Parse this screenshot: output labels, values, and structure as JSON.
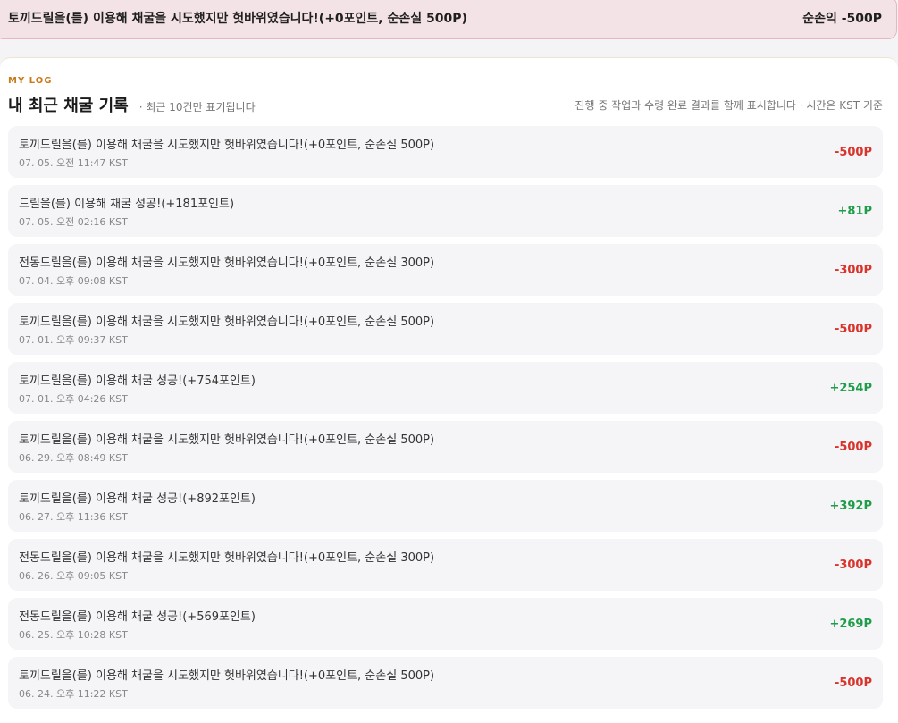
{
  "banner": {
    "message": "토끼드릴을(를) 이용해 채굴을 시도했지만 헛바위였습니다!(+0포인트, 순손실 500P)",
    "net_label": "순손익 -500P"
  },
  "section": {
    "kicker": "MY LOG",
    "title": "내 최근 채굴 기록",
    "subtitle": "· 최근 10건만 표기됩니다",
    "note": "진행 중 작업과 수령 완료 결과를 함께 표시합니다 · 시간은 KST 기준"
  },
  "colors": {
    "negative": "#d9342c",
    "positive": "#1f9d4a",
    "kicker": "#c97a1c",
    "banner_bg": "#f3e3e6"
  },
  "records": [
    {
      "message": "토끼드릴을(를) 이용해 채굴을 시도했지만 헛바위였습니다!(+0포인트, 순손실 500P)",
      "time": "07. 05. 오전 11:47 KST",
      "delta": "-500P",
      "sign": "neg"
    },
    {
      "message": "드릴을(를) 이용해 채굴 성공!(+181포인트)",
      "time": "07. 05. 오전 02:16 KST",
      "delta": "+81P",
      "sign": "pos"
    },
    {
      "message": "전동드릴을(를) 이용해 채굴을 시도했지만 헛바위였습니다!(+0포인트, 순손실 300P)",
      "time": "07. 04. 오후 09:08 KST",
      "delta": "-300P",
      "sign": "neg"
    },
    {
      "message": "토끼드릴을(를) 이용해 채굴을 시도했지만 헛바위였습니다!(+0포인트, 순손실 500P)",
      "time": "07. 01. 오후 09:37 KST",
      "delta": "-500P",
      "sign": "neg"
    },
    {
      "message": "토끼드릴을(를) 이용해 채굴 성공!(+754포인트)",
      "time": "07. 01. 오후 04:26 KST",
      "delta": "+254P",
      "sign": "pos"
    },
    {
      "message": "토끼드릴을(를) 이용해 채굴을 시도했지만 헛바위였습니다!(+0포인트, 순손실 500P)",
      "time": "06. 29. 오후 08:49 KST",
      "delta": "-500P",
      "sign": "neg"
    },
    {
      "message": "토끼드릴을(를) 이용해 채굴 성공!(+892포인트)",
      "time": "06. 27. 오후 11:36 KST",
      "delta": "+392P",
      "sign": "pos"
    },
    {
      "message": "전동드릴을(를) 이용해 채굴을 시도했지만 헛바위였습니다!(+0포인트, 순손실 300P)",
      "time": "06. 26. 오후 09:05 KST",
      "delta": "-300P",
      "sign": "neg"
    },
    {
      "message": "전동드릴을(를) 이용해 채굴 성공!(+569포인트)",
      "time": "06. 25. 오후 10:28 KST",
      "delta": "+269P",
      "sign": "pos"
    },
    {
      "message": "토끼드릴을(를) 이용해 채굴을 시도했지만 헛바위였습니다!(+0포인트, 순손실 500P)",
      "time": "06. 24. 오후 11:22 KST",
      "delta": "-500P",
      "sign": "neg"
    }
  ]
}
